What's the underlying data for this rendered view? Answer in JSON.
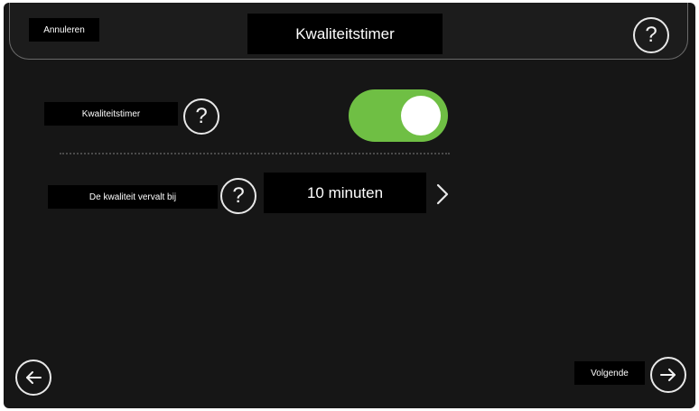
{
  "header": {
    "cancel_label": "Annuleren",
    "title": "Kwaliteitstimer",
    "help_icon": "question-icon"
  },
  "settings": {
    "timer_label": "Kwaliteitstimer",
    "timer_enabled": true,
    "toggle_color": "#6fbf44",
    "expiry_label": "De kwaliteit vervalt bij",
    "expiry_value": "10 minuten"
  },
  "footer": {
    "back_icon": "arrow-left-icon",
    "next_label": "Volgende",
    "next_icon": "arrow-right-icon"
  }
}
